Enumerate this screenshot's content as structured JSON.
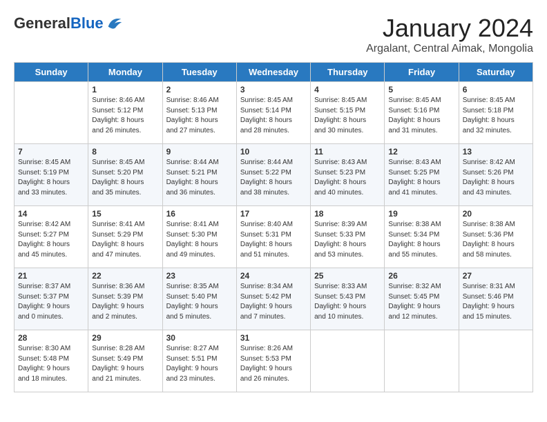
{
  "logo": {
    "general": "General",
    "blue": "Blue"
  },
  "header": {
    "month_title": "January 2024",
    "subtitle": "Argalant, Central Aimak, Mongolia"
  },
  "days_of_week": [
    "Sunday",
    "Monday",
    "Tuesday",
    "Wednesday",
    "Thursday",
    "Friday",
    "Saturday"
  ],
  "weeks": [
    [
      {
        "day": "",
        "info": ""
      },
      {
        "day": "1",
        "info": "Sunrise: 8:46 AM\nSunset: 5:12 PM\nDaylight: 8 hours\nand 26 minutes."
      },
      {
        "day": "2",
        "info": "Sunrise: 8:46 AM\nSunset: 5:13 PM\nDaylight: 8 hours\nand 27 minutes."
      },
      {
        "day": "3",
        "info": "Sunrise: 8:45 AM\nSunset: 5:14 PM\nDaylight: 8 hours\nand 28 minutes."
      },
      {
        "day": "4",
        "info": "Sunrise: 8:45 AM\nSunset: 5:15 PM\nDaylight: 8 hours\nand 30 minutes."
      },
      {
        "day": "5",
        "info": "Sunrise: 8:45 AM\nSunset: 5:16 PM\nDaylight: 8 hours\nand 31 minutes."
      },
      {
        "day": "6",
        "info": "Sunrise: 8:45 AM\nSunset: 5:18 PM\nDaylight: 8 hours\nand 32 minutes."
      }
    ],
    [
      {
        "day": "7",
        "info": "Sunrise: 8:45 AM\nSunset: 5:19 PM\nDaylight: 8 hours\nand 33 minutes."
      },
      {
        "day": "8",
        "info": "Sunrise: 8:45 AM\nSunset: 5:20 PM\nDaylight: 8 hours\nand 35 minutes."
      },
      {
        "day": "9",
        "info": "Sunrise: 8:44 AM\nSunset: 5:21 PM\nDaylight: 8 hours\nand 36 minutes."
      },
      {
        "day": "10",
        "info": "Sunrise: 8:44 AM\nSunset: 5:22 PM\nDaylight: 8 hours\nand 38 minutes."
      },
      {
        "day": "11",
        "info": "Sunrise: 8:43 AM\nSunset: 5:23 PM\nDaylight: 8 hours\nand 40 minutes."
      },
      {
        "day": "12",
        "info": "Sunrise: 8:43 AM\nSunset: 5:25 PM\nDaylight: 8 hours\nand 41 minutes."
      },
      {
        "day": "13",
        "info": "Sunrise: 8:42 AM\nSunset: 5:26 PM\nDaylight: 8 hours\nand 43 minutes."
      }
    ],
    [
      {
        "day": "14",
        "info": "Sunrise: 8:42 AM\nSunset: 5:27 PM\nDaylight: 8 hours\nand 45 minutes."
      },
      {
        "day": "15",
        "info": "Sunrise: 8:41 AM\nSunset: 5:29 PM\nDaylight: 8 hours\nand 47 minutes."
      },
      {
        "day": "16",
        "info": "Sunrise: 8:41 AM\nSunset: 5:30 PM\nDaylight: 8 hours\nand 49 minutes."
      },
      {
        "day": "17",
        "info": "Sunrise: 8:40 AM\nSunset: 5:31 PM\nDaylight: 8 hours\nand 51 minutes."
      },
      {
        "day": "18",
        "info": "Sunrise: 8:39 AM\nSunset: 5:33 PM\nDaylight: 8 hours\nand 53 minutes."
      },
      {
        "day": "19",
        "info": "Sunrise: 8:38 AM\nSunset: 5:34 PM\nDaylight: 8 hours\nand 55 minutes."
      },
      {
        "day": "20",
        "info": "Sunrise: 8:38 AM\nSunset: 5:36 PM\nDaylight: 8 hours\nand 58 minutes."
      }
    ],
    [
      {
        "day": "21",
        "info": "Sunrise: 8:37 AM\nSunset: 5:37 PM\nDaylight: 9 hours\nand 0 minutes."
      },
      {
        "day": "22",
        "info": "Sunrise: 8:36 AM\nSunset: 5:39 PM\nDaylight: 9 hours\nand 2 minutes."
      },
      {
        "day": "23",
        "info": "Sunrise: 8:35 AM\nSunset: 5:40 PM\nDaylight: 9 hours\nand 5 minutes."
      },
      {
        "day": "24",
        "info": "Sunrise: 8:34 AM\nSunset: 5:42 PM\nDaylight: 9 hours\nand 7 minutes."
      },
      {
        "day": "25",
        "info": "Sunrise: 8:33 AM\nSunset: 5:43 PM\nDaylight: 9 hours\nand 10 minutes."
      },
      {
        "day": "26",
        "info": "Sunrise: 8:32 AM\nSunset: 5:45 PM\nDaylight: 9 hours\nand 12 minutes."
      },
      {
        "day": "27",
        "info": "Sunrise: 8:31 AM\nSunset: 5:46 PM\nDaylight: 9 hours\nand 15 minutes."
      }
    ],
    [
      {
        "day": "28",
        "info": "Sunrise: 8:30 AM\nSunset: 5:48 PM\nDaylight: 9 hours\nand 18 minutes."
      },
      {
        "day": "29",
        "info": "Sunrise: 8:28 AM\nSunset: 5:49 PM\nDaylight: 9 hours\nand 21 minutes."
      },
      {
        "day": "30",
        "info": "Sunrise: 8:27 AM\nSunset: 5:51 PM\nDaylight: 9 hours\nand 23 minutes."
      },
      {
        "day": "31",
        "info": "Sunrise: 8:26 AM\nSunset: 5:53 PM\nDaylight: 9 hours\nand 26 minutes."
      },
      {
        "day": "",
        "info": ""
      },
      {
        "day": "",
        "info": ""
      },
      {
        "day": "",
        "info": ""
      }
    ]
  ]
}
